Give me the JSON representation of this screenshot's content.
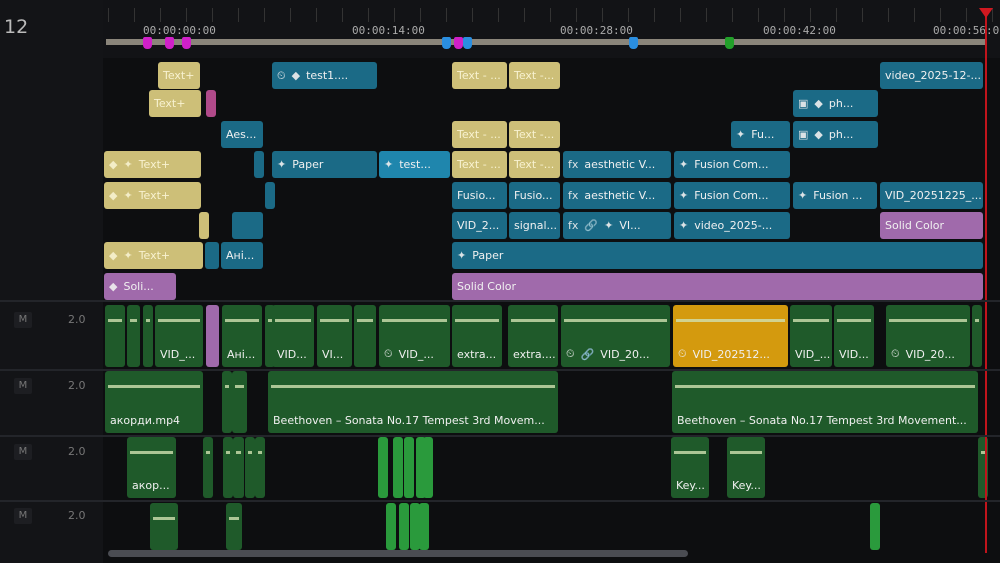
{
  "track_header": {
    "track_number": "12",
    "audio": [
      {
        "mute": "M",
        "level": "2.0"
      },
      {
        "mute": "M",
        "level": "2.0"
      },
      {
        "mute": "M",
        "level": "2.0"
      },
      {
        "mute": "M",
        "level": "2.0"
      }
    ]
  },
  "ruler": {
    "timecodes": [
      "00:00:00:00",
      "00:00:14:00",
      "00:00:28:00",
      "00:00:42:00",
      "00:00:56:00"
    ]
  },
  "colors": {
    "text": "#cdbf78",
    "fusion": "#1b6a86",
    "solid": "#a06aab",
    "audio": "#1f5a2a",
    "selected": "#d49a0e",
    "playhead": "#c0141c"
  },
  "video_clips": [
    "Text+",
    "test1....",
    "Text - ...",
    "Text -...",
    "video_2025-12-...",
    "Text+",
    "ph...",
    "Aes...",
    "Text - ...",
    "Text -...",
    "Fu...",
    "ph...",
    "Text+",
    "Paper",
    "test...",
    "Text - ...",
    "Text -...",
    "aesthetic V...",
    "Fusion Com...",
    "Text+",
    "Fusio...",
    "Fusio...",
    "aesthetic V...",
    "Fusion Com...",
    "Fusion ...",
    "VID_20251225_...",
    "VID_2...",
    "signal...",
    "VI...",
    "video_2025-...",
    "Solid Color",
    "Text+",
    "Ані...",
    "Paper",
    "Soli...",
    "Solid Color"
  ],
  "audio_clips": [
    "VID_...",
    "Ані...",
    "VID...",
    "VI...",
    "VID_...",
    "extra...",
    "extra....",
    "VID_20...",
    "VID_202512...",
    "VID_...",
    "VID...",
    "VID_20...",
    "акорди.mp4",
    "Beethoven – Sonata No.17 Tempest 3rd Movem...",
    "Beethoven – Sonata No.17 Tempest 3rd Movement...",
    "акор...",
    "Key...",
    "Key..."
  ]
}
